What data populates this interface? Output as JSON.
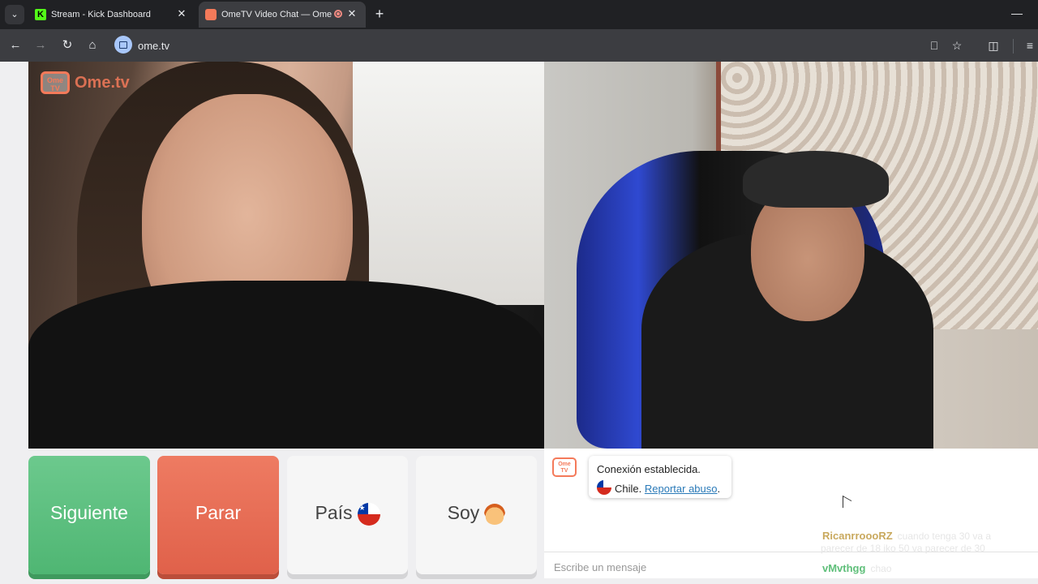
{
  "browser": {
    "tabs": [
      {
        "title": "Stream - Kick Dashboard",
        "favicon": "kick-icon",
        "active": false
      },
      {
        "title": "OmeTV Video Chat — Ome",
        "favicon": "ometv-icon",
        "active": true,
        "recording": true
      }
    ],
    "address": "ome.tv",
    "colors": {
      "tabbar": "#202124",
      "toolbar": "#3c3d41"
    }
  },
  "ome": {
    "logo_badge": "Ome TV",
    "logo_text": "Ome.tv",
    "colors": {
      "brand": "#f47a5a",
      "next": "#58bb7b",
      "stop": "#e56a52"
    }
  },
  "controls": {
    "next_label": "Siguiente",
    "stop_label": "Parar",
    "country_label": "País",
    "country_flag": "chile-flag",
    "gender_label": "Soy",
    "gender_icon": "boy-emoji"
  },
  "chat": {
    "system_badge": "Ome TV",
    "system_line1": "Conexión establecida.",
    "country": "Chile.",
    "report_link": "Reportar abuso",
    "report_suffix": ".",
    "input_placeholder": "Escribe un mensaje"
  },
  "stream_overlay": [
    {
      "user": "RicanrroooRZ",
      "text": "cuando tenga 30 va a",
      "text2": "parecer de 18 iko 50 va parecer de 30"
    },
    {
      "user": "vMvthgg",
      "text": "chao"
    }
  ]
}
